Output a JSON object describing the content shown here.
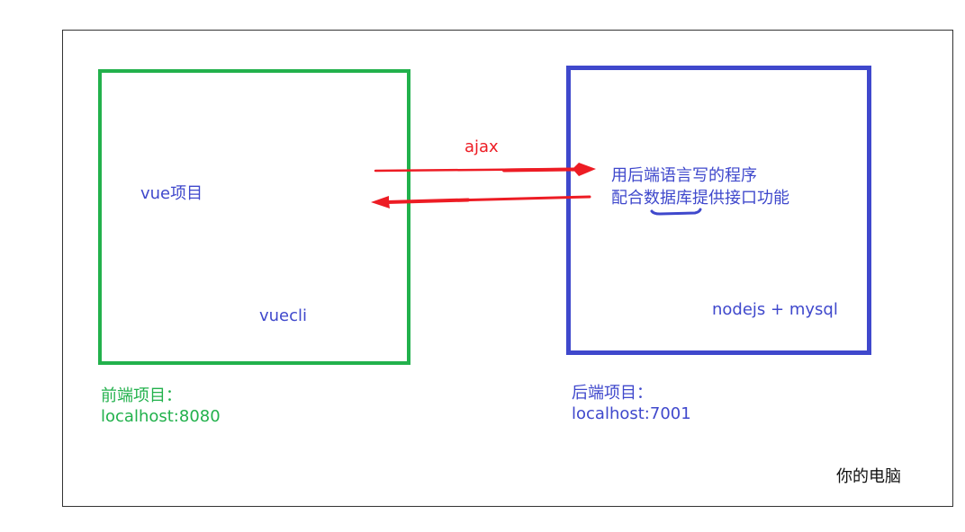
{
  "frontend_box": {
    "label": "vue项目",
    "tool": "vuecli",
    "caption_title": "前端项目：",
    "caption_host": "localhost:8080"
  },
  "backend_box": {
    "desc_line1": "用后端语言写的程序",
    "desc_line2": "配合数据库提供接口功能",
    "stack": "nodejs + mysql",
    "caption_title": "后端项目：",
    "caption_host": "localhost:7001"
  },
  "arrow_label": "ajax",
  "computer_label": "你的电脑",
  "colors": {
    "frontend": "#22b14c",
    "backend": "#3f48cc",
    "arrow": "#ed1c24",
    "frame": "#333333"
  }
}
